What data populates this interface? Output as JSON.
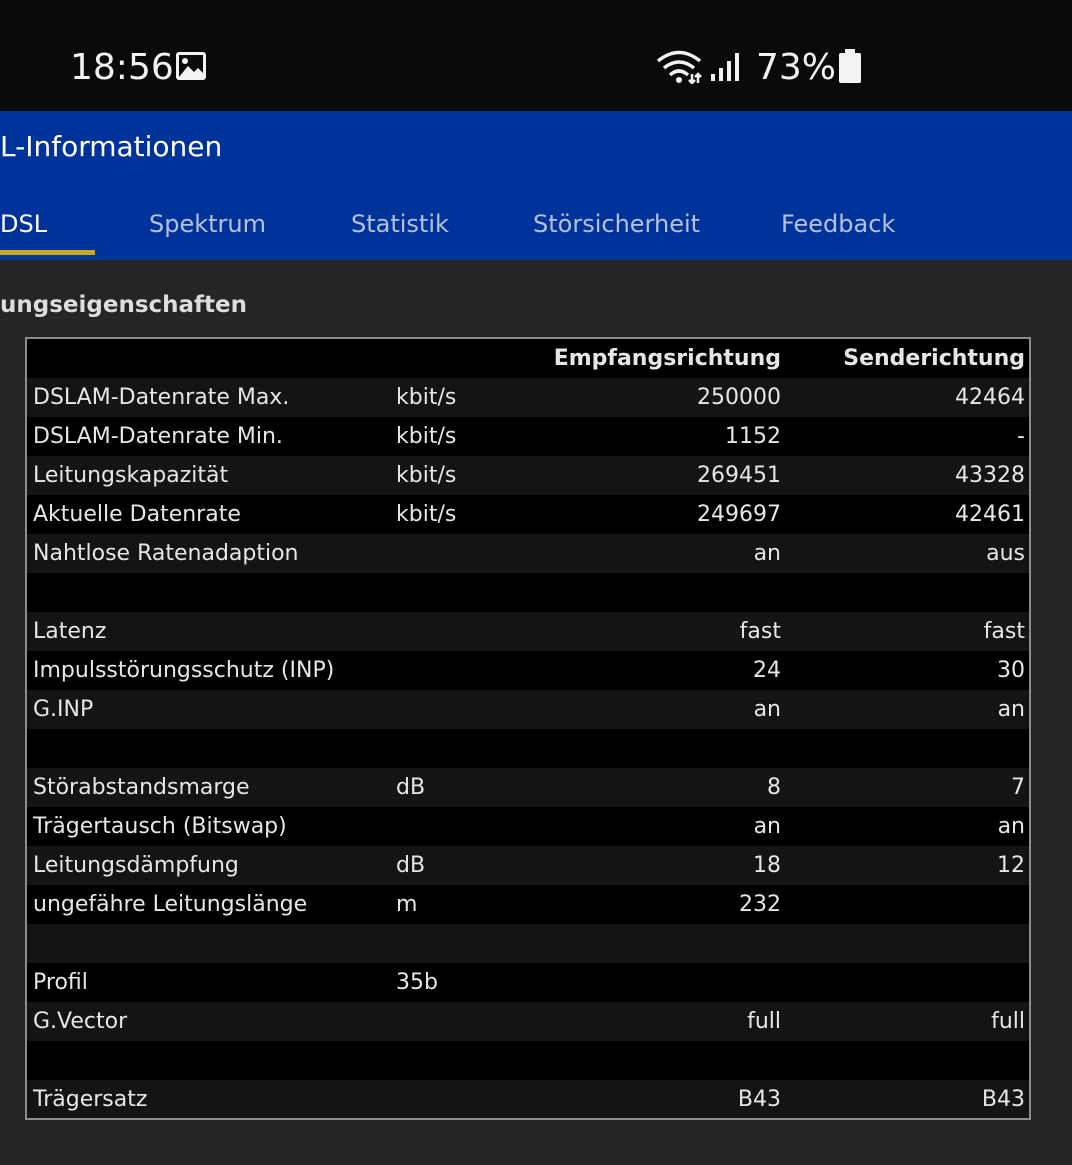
{
  "status_bar": {
    "time": "18:56",
    "battery": "73%",
    "icons": [
      "image-icon",
      "wifi-icon",
      "signal-icon",
      "battery-icon"
    ]
  },
  "app_bar": {
    "title": "L-Informationen",
    "tabs": [
      {
        "label": "DSL",
        "active": true
      },
      {
        "label": "Spektrum",
        "active": false
      },
      {
        "label": "Statistik",
        "active": false
      },
      {
        "label": "Störsicherheit",
        "active": false
      },
      {
        "label": "Feedback",
        "active": false
      }
    ],
    "colors": {
      "background": "#003399",
      "indicator": "#c9a825"
    }
  },
  "section": {
    "title": "ungseigenschaften"
  },
  "table": {
    "headers": {
      "label": "",
      "unit": "",
      "down": "Empfangsrichtung",
      "up": "Senderichtung"
    },
    "rows": [
      {
        "label": "DSLAM-Datenrate Max.",
        "unit": "kbit/s",
        "down": "250000",
        "up": "42464"
      },
      {
        "label": "DSLAM-Datenrate Min.",
        "unit": "kbit/s",
        "down": "1152",
        "up": "-"
      },
      {
        "label": "Leitungskapazität",
        "unit": "kbit/s",
        "down": "269451",
        "up": "43328"
      },
      {
        "label": "Aktuelle Datenrate",
        "unit": "kbit/s",
        "down": "249697",
        "up": "42461"
      },
      {
        "label": "Nahtlose Ratenadaption",
        "unit": "",
        "down": "an",
        "up": "aus"
      },
      {
        "label": "",
        "unit": "",
        "down": "",
        "up": ""
      },
      {
        "label": "Latenz",
        "unit": "",
        "down": "fast",
        "up": "fast"
      },
      {
        "label": "Impulsstörungsschutz (INP)",
        "unit": "",
        "down": "24",
        "up": "30"
      },
      {
        "label": "G.INP",
        "unit": "",
        "down": "an",
        "up": "an"
      },
      {
        "label": "",
        "unit": "",
        "down": "",
        "up": ""
      },
      {
        "label": "Störabstandsmarge",
        "unit": "dB",
        "down": "8",
        "up": "7"
      },
      {
        "label": "Trägertausch (Bitswap)",
        "unit": "",
        "down": "an",
        "up": "an"
      },
      {
        "label": "Leitungsdämpfung",
        "unit": "dB",
        "down": "18",
        "up": "12"
      },
      {
        "label": "ungefähre Leitungslänge",
        "unit": "m",
        "down": "232",
        "up": ""
      },
      {
        "label": "",
        "unit": "",
        "down": "",
        "up": ""
      },
      {
        "label": "Profil",
        "unit": "35b",
        "down": "",
        "up": ""
      },
      {
        "label": "G.Vector",
        "unit": "",
        "down": "full",
        "up": "full"
      },
      {
        "label": "",
        "unit": "",
        "down": "",
        "up": ""
      },
      {
        "label": "Trägersatz",
        "unit": "",
        "down": "B43",
        "up": "B43"
      }
    ]
  }
}
